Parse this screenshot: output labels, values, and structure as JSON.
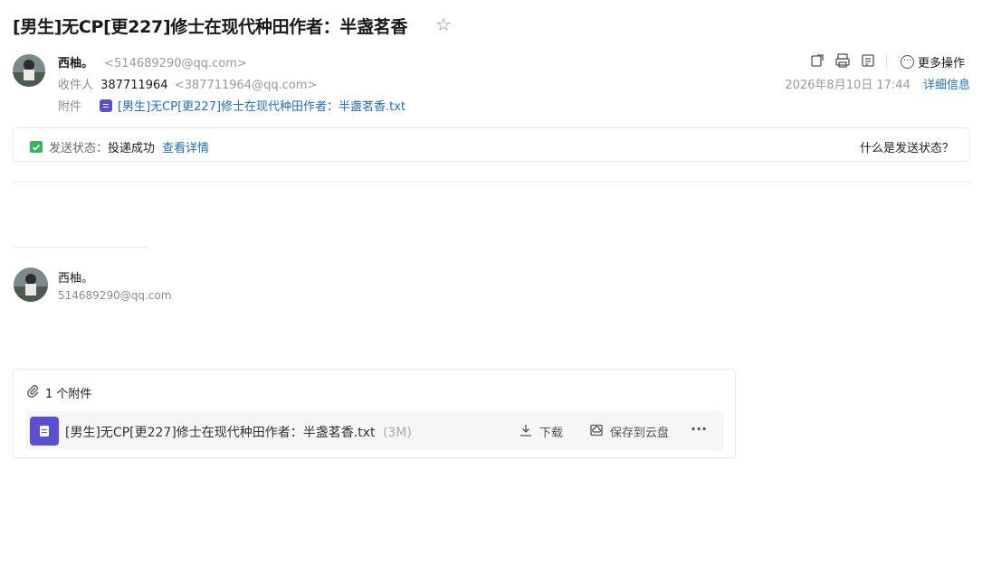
{
  "mail": {
    "subject": "[男生]无CP[更227]修士在现代种田作者：半盏茗香",
    "sender_name": "西柚。",
    "sender_email": "<514689290@qq.com>",
    "recipient_label": "收件人",
    "recipient_name": "387711964",
    "recipient_email": "<387711964@qq.com>",
    "attachment_label": "附件",
    "attachment_inline_name": "[男生]无CP[更227]修士在现代种田作者：半盏茗香.txt",
    "date": "2026年8月10日 17:44",
    "details_link": "详细信息",
    "more_actions": "更多操作"
  },
  "status": {
    "label": "发送状态：",
    "value": "投递成功",
    "view_details": "查看详情",
    "help_link": "什么是发送状态？"
  },
  "signature": {
    "name": "西柚。",
    "email": "514689290@qq.com"
  },
  "attachments": {
    "count_label": "1 个附件",
    "file_name": "[男生]无CP[更227]修士在现代种田作者：半盏茗香.txt",
    "file_size": "(3M)",
    "download_label": "下载",
    "save_cloud_label": "保存到云盘",
    "more_label": "···"
  },
  "colors": {
    "accent_link": "#1f6fb3",
    "file_icon": "#5b4fd1",
    "success_green": "#3bb55d"
  }
}
